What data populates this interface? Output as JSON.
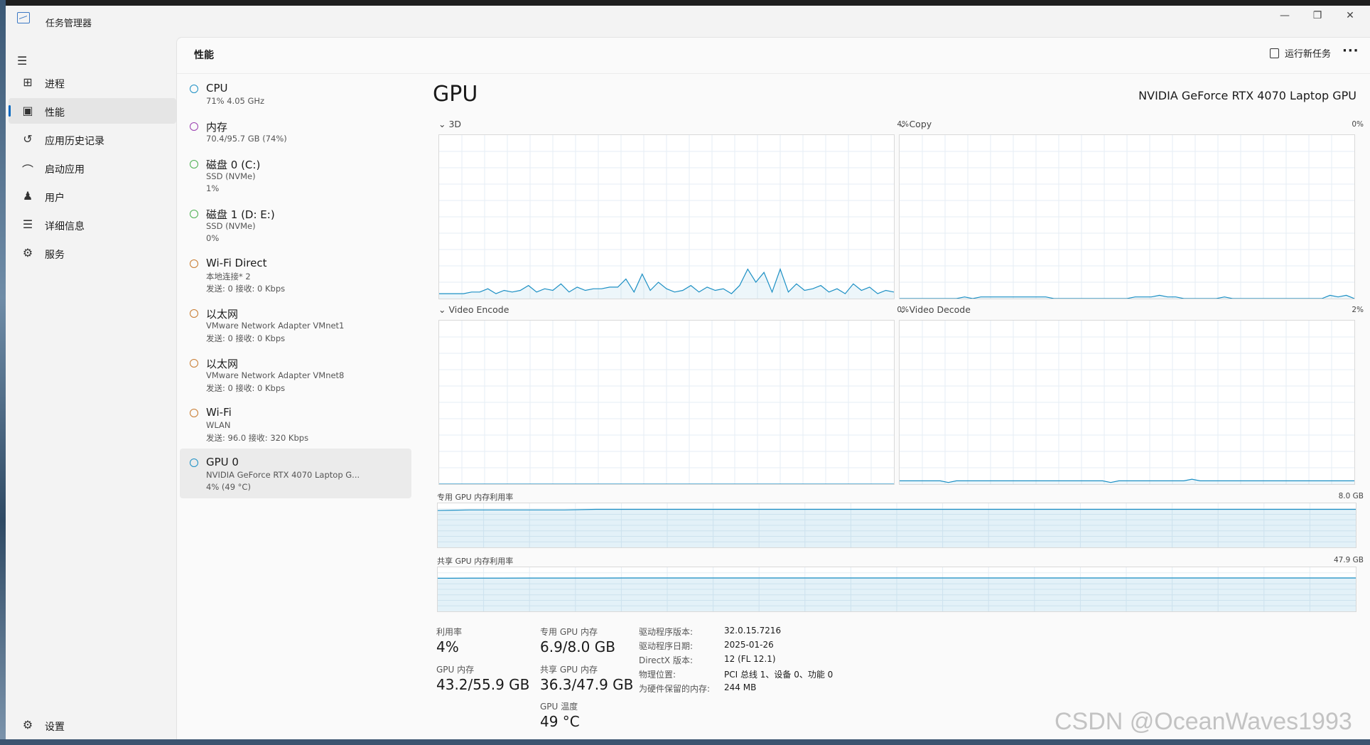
{
  "window": {
    "title": "任务管理器",
    "minimize": "—",
    "maximize": "❐",
    "close": "✕"
  },
  "sidebar": {
    "items": [
      {
        "label": "进程",
        "icon": "processes-icon",
        "glyph": "⊞"
      },
      {
        "label": "性能",
        "icon": "performance-icon",
        "glyph": "▣",
        "selected": true
      },
      {
        "label": "应用历史记录",
        "icon": "app-history-icon",
        "glyph": "↺"
      },
      {
        "label": "启动应用",
        "icon": "startup-icon",
        "glyph": "⌒"
      },
      {
        "label": "用户",
        "icon": "users-icon",
        "glyph": "♟"
      },
      {
        "label": "详细信息",
        "icon": "details-icon",
        "glyph": "☰"
      },
      {
        "label": "服务",
        "icon": "services-icon",
        "glyph": "⚙"
      }
    ],
    "settings": {
      "label": "设置",
      "icon": "settings-icon",
      "glyph": "⚙"
    }
  },
  "header": {
    "title": "性能",
    "run_task": "运行新任务",
    "more": "···"
  },
  "devices": [
    {
      "name": "CPU",
      "line1": "71% 4.05 GHz",
      "line2": "",
      "color": "#1b8fc4"
    },
    {
      "name": "内存",
      "line1": "70.4/95.7 GB (74%)",
      "line2": "",
      "color": "#9b3fb0"
    },
    {
      "name": "磁盘 0 (C:)",
      "line1": "SSD (NVMe)",
      "line2": "1%",
      "color": "#4caf50"
    },
    {
      "name": "磁盘 1 (D: E:)",
      "line1": "SSD (NVMe)",
      "line2": "0%",
      "color": "#4caf50"
    },
    {
      "name": "Wi-Fi Direct",
      "line1": "本地连接* 2",
      "line2": "发送: 0 接收: 0 Kbps",
      "color": "#c77a2e"
    },
    {
      "name": "以太网",
      "line1": "VMware Network Adapter VMnet1",
      "line2": "发送: 0 接收: 0 Kbps",
      "color": "#c77a2e"
    },
    {
      "name": "以太网",
      "line1": "VMware Network Adapter VMnet8",
      "line2": "发送: 0 接收: 0 Kbps",
      "color": "#c77a2e"
    },
    {
      "name": "Wi-Fi",
      "line1": "WLAN",
      "line2": "发送: 96.0 接收: 320 Kbps",
      "color": "#c77a2e"
    },
    {
      "name": "GPU 0",
      "line1": "NVIDIA GeForce RTX 4070 Laptop G...",
      "line2": "4% (49 °C)",
      "color": "#1b8fc4",
      "selected": true
    }
  ],
  "gpu": {
    "title": "GPU",
    "model": "NVIDIA GeForce RTX 4070 Laptop GPU",
    "engines": [
      {
        "name": "3D",
        "percent": "4%",
        "values": [
          3,
          3,
          3,
          3,
          4,
          4,
          6,
          3,
          5,
          4,
          5,
          8,
          4,
          6,
          5,
          9,
          4,
          7,
          5,
          6,
          6,
          7,
          7,
          12,
          4,
          15,
          5,
          10,
          6,
          4,
          5,
          8,
          4,
          7,
          5,
          6,
          3,
          8,
          18,
          10,
          16,
          4,
          18,
          4,
          9,
          5,
          6,
          8,
          4,
          6,
          3,
          9,
          5,
          7,
          3,
          5,
          4
        ]
      },
      {
        "name": "Copy",
        "percent": "0%",
        "values": [
          0,
          0,
          0,
          0,
          0,
          0,
          0,
          0,
          1,
          0,
          1,
          1,
          1,
          1,
          1,
          1,
          1,
          1,
          1,
          0,
          0,
          0,
          0,
          0,
          0,
          0,
          0,
          0,
          0,
          1,
          1,
          1,
          2,
          1,
          1,
          0,
          0,
          0,
          0,
          0,
          1,
          0,
          0,
          0,
          0,
          0,
          0,
          0,
          0,
          0,
          0,
          0,
          0,
          2,
          1,
          2,
          0
        ]
      },
      {
        "name": "Video Encode",
        "percent": "0%",
        "values": [
          0,
          0,
          0,
          0,
          0,
          0,
          0,
          0,
          0,
          0,
          0,
          0,
          0,
          0,
          0,
          0,
          0,
          0,
          0,
          0,
          0,
          0,
          0,
          0,
          0,
          0,
          0,
          0,
          0,
          0,
          0,
          0,
          0,
          0,
          0,
          0,
          0,
          0,
          0,
          0,
          0,
          0,
          0,
          0,
          0,
          0,
          0,
          0,
          0,
          0,
          0,
          0,
          0,
          0,
          0,
          0,
          0
        ]
      },
      {
        "name": "Video Decode",
        "percent": "2%",
        "values": [
          2,
          2,
          2,
          2,
          2,
          2,
          1,
          2,
          2,
          2,
          2,
          2,
          2,
          2,
          2,
          2,
          2,
          2,
          2,
          2,
          2,
          2,
          2,
          2,
          2,
          2,
          1,
          2,
          2,
          2,
          2,
          2,
          2,
          2,
          2,
          2,
          3,
          2,
          2,
          2,
          2,
          2,
          2,
          2,
          2,
          2,
          2,
          2,
          2,
          2,
          2,
          2,
          2,
          2,
          2,
          2,
          2
        ]
      }
    ],
    "dedicated_memory": {
      "label": "专用 GPU 内存利用率",
      "max": "8.0 GB",
      "values": [
        6.7,
        6.8,
        6.8,
        6.8,
        6.8,
        6.9,
        6.9,
        6.9,
        6.9,
        6.9,
        6.9,
        6.9,
        6.9,
        6.9,
        6.9,
        6.9,
        6.9,
        6.9,
        6.9,
        6.9,
        6.9,
        6.9,
        6.9,
        6.9,
        6.9,
        6.9,
        6.9,
        6.9,
        6.9,
        6.9
      ]
    },
    "shared_memory": {
      "label": "共享 GPU 内存利用率",
      "max": "47.9 GB",
      "values": [
        36.0,
        36.1,
        36.1,
        36.2,
        36.2,
        36.2,
        36.3,
        36.3,
        36.3,
        36.3,
        36.3,
        36.3,
        36.3,
        36.3,
        36.3,
        36.3,
        36.3,
        36.3,
        36.3,
        36.3,
        36.3,
        36.3,
        36.3,
        36.3,
        36.3,
        36.3,
        36.3,
        36.3,
        36.3,
        36.3
      ]
    },
    "stats": {
      "utilization_label": "利用率",
      "utilization": "4%",
      "gpu_mem_label": "GPU 内存",
      "gpu_mem": "43.2/55.9 GB",
      "dedicated_label": "专用 GPU 内存",
      "dedicated": "6.9/8.0 GB",
      "shared_label": "共享 GPU 内存",
      "shared": "36.3/47.9 GB",
      "temp_label": "GPU 温度",
      "temp": "49 °C"
    },
    "info": [
      {
        "key": "驱动程序版本:",
        "value": "32.0.15.7216"
      },
      {
        "key": "驱动程序日期:",
        "value": "2025-01-26"
      },
      {
        "key": "DirectX 版本:",
        "value": "12 (FL 12.1)"
      },
      {
        "key": "物理位置:",
        "value": "PCI 总线 1、设备 0、功能 0"
      },
      {
        "key": "为硬件保留的内存:",
        "value": "244 MB"
      }
    ]
  },
  "watermark": "CSDN @OceanWaves1993",
  "colors": {
    "accent": "#0067c0",
    "graph_line": "#1b8fc4",
    "grid": "#e6eef4"
  }
}
